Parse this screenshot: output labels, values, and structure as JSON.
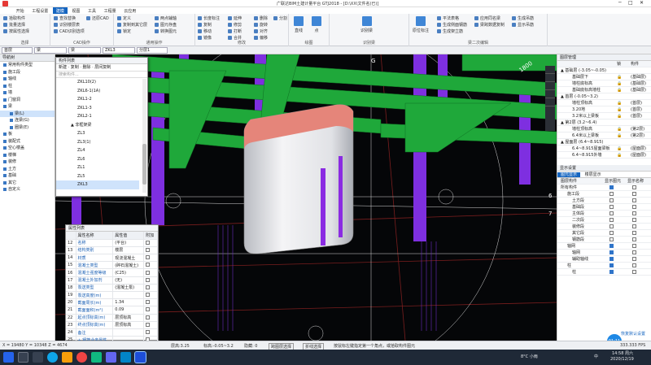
{
  "window": {
    "title": "广联达BIM土建计量平台 GTJ2018 - [D:\\XX\\文件名(已)]"
  },
  "menu": [
    "开始",
    "工程设置",
    "建模",
    "视图",
    "工具",
    "工程量",
    "云应用"
  ],
  "menu_active_index": 2,
  "ribbon": {
    "groups": [
      {
        "label": "选择",
        "buttons": [
          "拾取构件",
          "批量选择",
          "按属性选择"
        ]
      },
      {
        "label": "CAD操作",
        "buttons": [
          "查找替换",
          "识别楼层表",
          "CAD识别选项",
          "还原CAD"
        ]
      },
      {
        "label": "通用操作",
        "buttons": [
          "定义",
          "复制到其它层",
          "锁定",
          "两点辅轴",
          "图元存盘",
          "转换图元"
        ]
      },
      {
        "label": "修改",
        "buttons": [
          "长度标注",
          "复制",
          "移动",
          "镜像",
          "延伸",
          "修剪",
          "打断",
          "合并",
          "删除",
          "旋转",
          "对齐",
          "偏移",
          "分割"
        ]
      },
      {
        "label": "绘图",
        "buttons": [
          "直线",
          "点"
        ]
      },
      {
        "label": "识别梁",
        "buttons": [
          "识别梁"
        ]
      },
      {
        "label": "梁二次编辑",
        "buttons": [
          "原位标注",
          "平法表格",
          "生成侧面钢筋",
          "生成架立筋",
          "应用同名梁",
          "梁跨数据复制",
          "生成吊筋",
          "显示吊筋"
        ]
      }
    ]
  },
  "selectors": {
    "floor": "首层",
    "category": "梁",
    "type": "梁",
    "component": "ZKL3",
    "layer": "分层1"
  },
  "left_nav": {
    "header": "导航树",
    "items": [
      {
        "label": "常用构件类型",
        "sub": false
      },
      {
        "label": "施工段",
        "sub": false
      },
      {
        "label": "轴线",
        "sub": false
      },
      {
        "label": "柱",
        "sub": false
      },
      {
        "label": "墙",
        "sub": false
      },
      {
        "label": "门窗洞",
        "sub": false
      },
      {
        "label": "梁",
        "sub": false
      },
      {
        "label": "梁(L)",
        "sub": true,
        "selected": true
      },
      {
        "label": "连梁(G)",
        "sub": true
      },
      {
        "label": "圈梁(E)",
        "sub": true
      },
      {
        "label": "板",
        "sub": false
      },
      {
        "label": "装配式",
        "sub": false
      },
      {
        "label": "空心楼盖",
        "sub": false
      },
      {
        "label": "楼梯",
        "sub": false
      },
      {
        "label": "装修",
        "sub": false
      },
      {
        "label": "土方",
        "sub": false
      },
      {
        "label": "基础",
        "sub": false
      },
      {
        "label": "其它",
        "sub": false
      },
      {
        "label": "自定义",
        "sub": false
      }
    ]
  },
  "component_list": {
    "header": "构件列表",
    "toolbar": "新建 · 复制 · 删除 · 层间复制",
    "search_placeholder": "搜索构件...",
    "items": [
      {
        "label": "ZKL10(2)",
        "group": false
      },
      {
        "label": "ZKL6-1(1A)",
        "group": false
      },
      {
        "label": "ZKL1-2",
        "group": false
      },
      {
        "label": "ZKL1-3",
        "group": false
      },
      {
        "label": "ZKL2-1",
        "group": false
      },
      {
        "label": "▲ 非框架梁",
        "group": true
      },
      {
        "label": "ZL3",
        "group": false
      },
      {
        "label": "ZL3(1)",
        "group": false
      },
      {
        "label": "ZL4",
        "group": false
      },
      {
        "label": "ZL6",
        "group": false
      },
      {
        "label": "ZL1",
        "group": false
      },
      {
        "label": "ZL5",
        "group": false
      },
      {
        "label": "ZKL3",
        "group": false,
        "selected": true
      }
    ]
  },
  "properties": {
    "header": "属性列表",
    "columns": [
      "属性名称",
      "属性值",
      "附加"
    ],
    "rows": [
      {
        "no": "12",
        "name": "名称",
        "value": "(平台)",
        "extra": false
      },
      {
        "no": "13",
        "name": "结构类别",
        "value": "楼层",
        "extra": false
      },
      {
        "no": "14",
        "name": "材质",
        "value": "现浇混凝土",
        "extra": false
      },
      {
        "no": "15",
        "name": "混凝土类型",
        "value": "(碎石混凝土)",
        "extra": false
      },
      {
        "no": "16",
        "name": "混凝土强度等级",
        "value": "(C25)",
        "extra": false
      },
      {
        "no": "17",
        "name": "混凝土外加剂",
        "value": "(无)",
        "extra": false
      },
      {
        "no": "18",
        "name": "泵送类型",
        "value": "(混凝土泵)",
        "extra": false
      },
      {
        "no": "19",
        "name": "泵送高度(m)",
        "value": "",
        "extra": false
      },
      {
        "no": "20",
        "name": "截面周长(m)",
        "value": "1.34",
        "extra": false
      },
      {
        "no": "21",
        "name": "截面面积(m²)",
        "value": "0.09",
        "extra": false
      },
      {
        "no": "22",
        "name": "起点顶标高(m)",
        "value": "层顶标高",
        "extra": false
      },
      {
        "no": "23",
        "name": "终点顶标高(m)",
        "value": "层顶标高",
        "extra": false
      },
      {
        "no": "24",
        "name": "备注",
        "value": "",
        "extra": false
      },
      {
        "no": "25",
        "name": "+ 钢筋业务属性",
        "value": "",
        "extra": false
      },
      {
        "no": "35",
        "name": "+ 土建业务属性",
        "value": "",
        "extra": false
      }
    ]
  },
  "floor_panel": {
    "header": "图层管理",
    "columns": [
      "",
      "锁",
      "构件"
    ],
    "rows": [
      {
        "label": "▲ 基础层 (-3.05~-0.05)",
        "level": 0,
        "c2": "",
        "c3": ""
      },
      {
        "label": "基础层下",
        "level": 2,
        "c2": "🔒",
        "c3": "(基础层)"
      },
      {
        "label": "墙柱底标高",
        "level": 2,
        "c2": "🔒",
        "c3": "(基础层)"
      },
      {
        "label": "基础底标高墙柱",
        "level": 2,
        "c2": "🔒",
        "c3": "(基础层)"
      },
      {
        "label": "▲ 首层 (-0.05~3.2)",
        "level": 0,
        "c2": "",
        "c3": ""
      },
      {
        "label": "墙柱顶标高",
        "level": 2,
        "c2": "🔒",
        "c3": "(首层)"
      },
      {
        "label": "3.20地",
        "level": 2,
        "c2": "🔒",
        "c3": "(首层)"
      },
      {
        "label": "3.2米以上梁板",
        "level": 2,
        "c2": "🔒",
        "c3": "(首层)"
      },
      {
        "label": "▲ 第2层 (3.2~6.4)",
        "level": 0,
        "c2": "",
        "c3": ""
      },
      {
        "label": "墙柱顶标高",
        "level": 2,
        "c2": "🔒",
        "c3": "(第2层)"
      },
      {
        "label": "6.4米以上梁板",
        "level": 2,
        "c2": "🔒",
        "c3": "(第2层)"
      },
      {
        "label": "▲ 屋面层 (6.4~8.915)",
        "level": 0,
        "c2": "",
        "c3": ""
      },
      {
        "label": "6.4~8.915屋面梁板",
        "level": 2,
        "c2": "🔒",
        "c3": "(屋面层)"
      },
      {
        "label": "6.4~8.915外墙",
        "level": 2,
        "c2": "🔒",
        "c3": "(屋面层)"
      }
    ]
  },
  "display_panel": {
    "header": "显示设置",
    "tabs": [
      "图元显示",
      "楼层显示"
    ],
    "columns": [
      "图层构件",
      "显示图元",
      "显示名称"
    ],
    "rows": [
      {
        "label": "所有构件",
        "level": 0,
        "show": true,
        "name": false
      },
      {
        "label": "施工段",
        "level": 1,
        "show": false,
        "name": false
      },
      {
        "label": "土方段",
        "level": 2,
        "show": false,
        "name": false
      },
      {
        "label": "基础段",
        "level": 2,
        "show": false,
        "name": false
      },
      {
        "label": "主体段",
        "level": 2,
        "show": false,
        "name": false
      },
      {
        "label": "二次段",
        "level": 2,
        "show": false,
        "name": false
      },
      {
        "label": "装修段",
        "level": 2,
        "show": false,
        "name": false
      },
      {
        "label": "其它段",
        "level": 2,
        "show": false,
        "name": false
      },
      {
        "label": "钢筋段",
        "level": 2,
        "show": false,
        "name": false
      },
      {
        "label": "轴网",
        "level": 1,
        "show": true,
        "name": false
      },
      {
        "label": "轴网",
        "level": 2,
        "show": true,
        "name": false
      },
      {
        "label": "辅助轴线",
        "level": 2,
        "show": true,
        "name": false
      },
      {
        "label": "柱",
        "level": 1,
        "show": true,
        "name": false
      },
      {
        "label": "柱",
        "level": 2,
        "show": true,
        "name": false
      }
    ],
    "restore_button": "恢复默认设置"
  },
  "viewport": {
    "axis_labels": [
      "G",
      "6",
      "7",
      "1800"
    ],
    "dimension": "1800"
  },
  "statusbar": {
    "coords": "X = 19480 Y = 10348 Z = 4674",
    "layer_height": "层高:3.25",
    "floor_elev": "标高:-0.05~3.2",
    "hidden": "隐藏: 0",
    "cross_select": "跨图层选择",
    "polyline": "折线选择",
    "hint": "按鼠标左键指定第一个角点，或拾取构件图元"
  },
  "taskbar": {
    "weather": "8°C 小雨",
    "time": "14:58 周六",
    "date": "2020/12/19",
    "fps": "333.333 FPS",
    "lang": "中"
  },
  "colors": {
    "accent": "#1565c0",
    "beam": "#1fa83a",
    "column": "#8a2be2",
    "cap": "#e5857a"
  }
}
